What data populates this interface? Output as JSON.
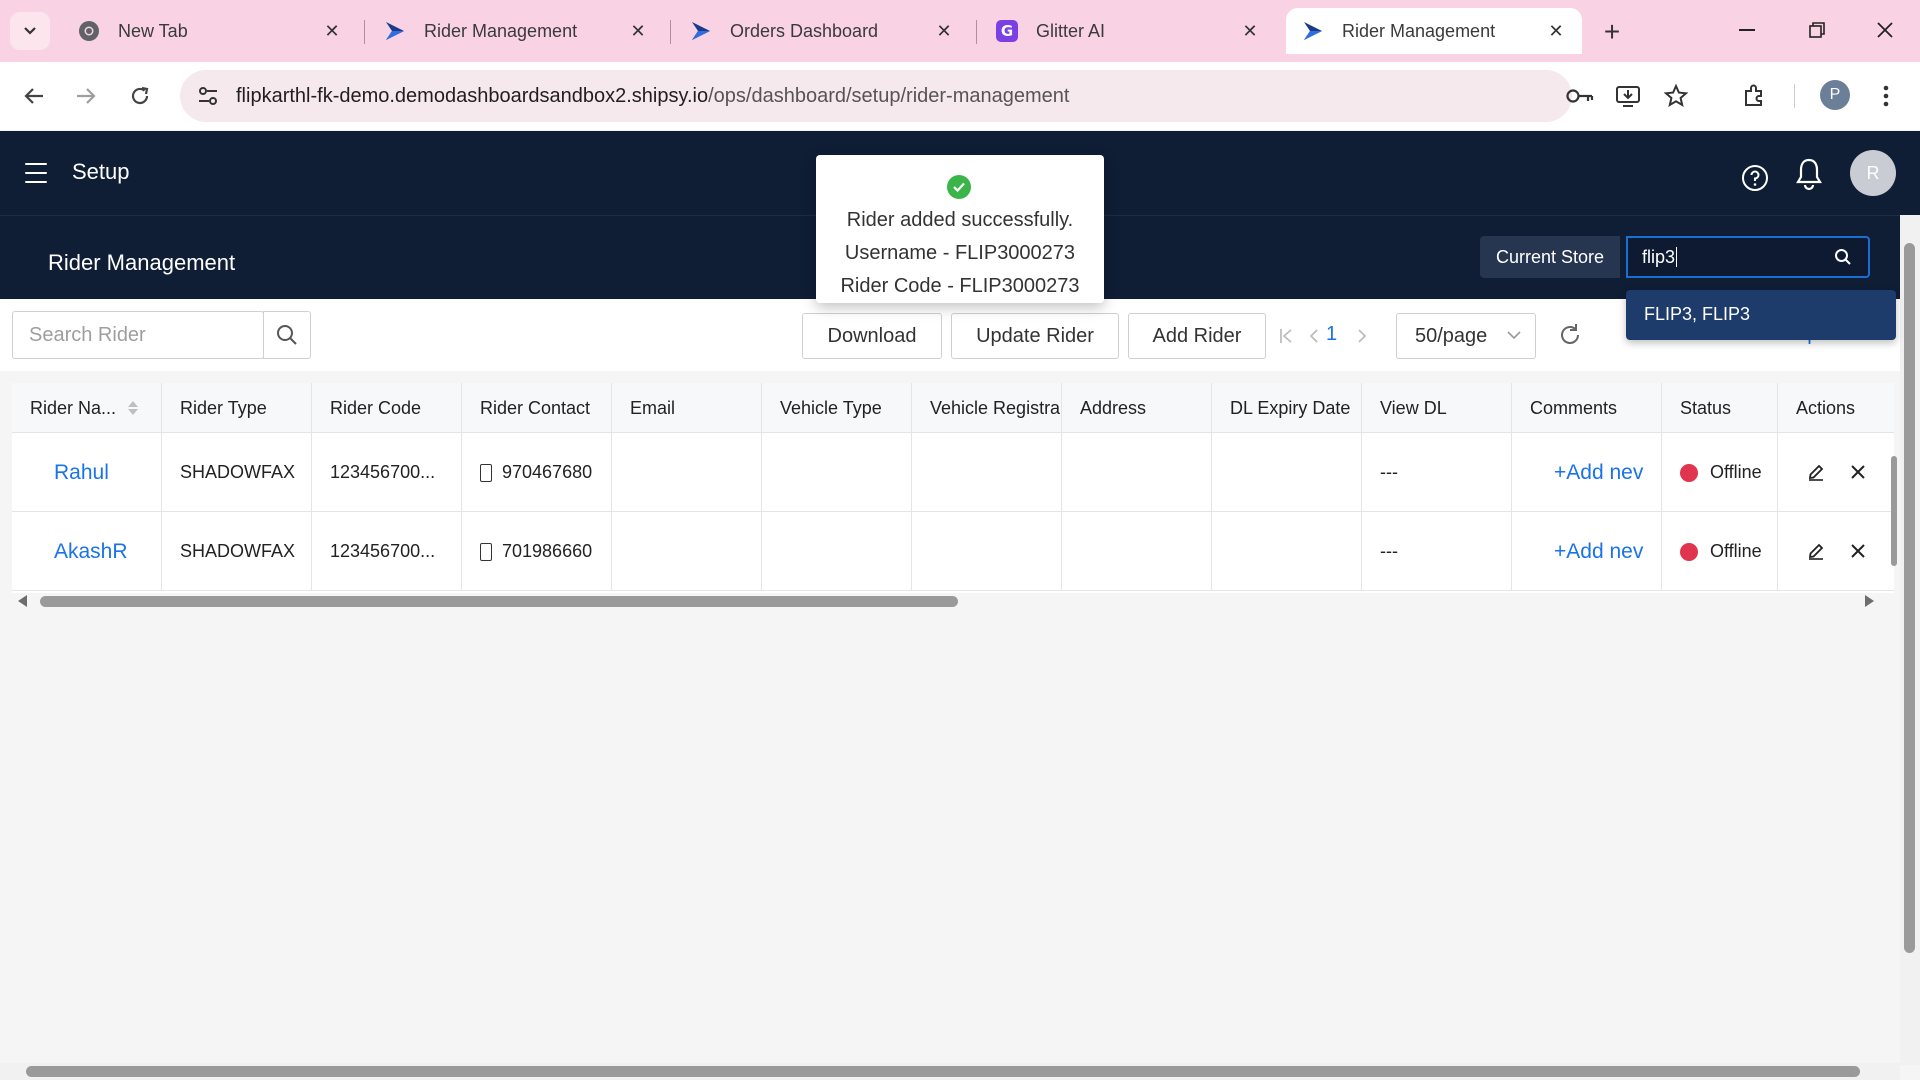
{
  "browser": {
    "tabs": [
      {
        "title": "New Tab",
        "icon": "chrome-icon"
      },
      {
        "title": "Rider Management",
        "icon": "shipsy-icon"
      },
      {
        "title": "Orders Dashboard",
        "icon": "shipsy-icon"
      },
      {
        "title": "Glitter AI",
        "icon": "glitter-icon"
      },
      {
        "title": "Rider Management",
        "icon": "shipsy-icon",
        "active": true
      }
    ],
    "url_host": "flipkarthl-fk-demo.demodashboardsandbox2.shipsy.io",
    "url_path": "/ops/dashboard/setup/rider-management",
    "profile_initial": "P"
  },
  "header": {
    "title": "Setup",
    "user_initial": "R"
  },
  "subheader": {
    "page_title": "Rider Management",
    "store_label": "Current Store",
    "store_value": "flip3",
    "dropdown_option": "FLIP3, FLIP3"
  },
  "toast": {
    "line1": "Rider added successfully.",
    "line2": "Username - FLIP3000273",
    "line3": "Rider Code - FLIP3000273"
  },
  "toolbar": {
    "search_placeholder": "Search Rider",
    "download_label": "Download",
    "update_rider_label": "Update Rider",
    "add_rider_label": "Add Rider",
    "page_number": "1",
    "page_size": "50/page",
    "view_download_requests": "View Download Requests"
  },
  "table": {
    "columns": [
      "Rider Na...",
      "Rider Type",
      "Rider Code",
      "Rider Contact",
      "Email",
      "Vehicle Type",
      "Vehicle Registra",
      "Address",
      "DL Expiry Date",
      "View DL",
      "Comments",
      "Status",
      "Actions"
    ],
    "rows": [
      {
        "name": "Rahul",
        "type": "SHADOWFAX",
        "code": "123456700...",
        "contact": "970467680",
        "email": "",
        "vehicle_type": "",
        "vehicle_reg": "",
        "address": "",
        "dl_expiry": "",
        "view_dl": "---",
        "comments": "+Add nev",
        "status": "Offline"
      },
      {
        "name": "AkashR",
        "type": "SHADOWFAX",
        "code": "123456700...",
        "contact": "701986660",
        "email": "",
        "vehicle_type": "",
        "vehicle_reg": "",
        "address": "",
        "dl_expiry": "",
        "view_dl": "---",
        "comments": "+Add nev",
        "status": "Offline"
      }
    ]
  },
  "colors": {
    "header_bg": "#0f1d35",
    "link": "#1a73e8",
    "offline": "#e0344f",
    "tabstrip": "#f9d3e3"
  }
}
